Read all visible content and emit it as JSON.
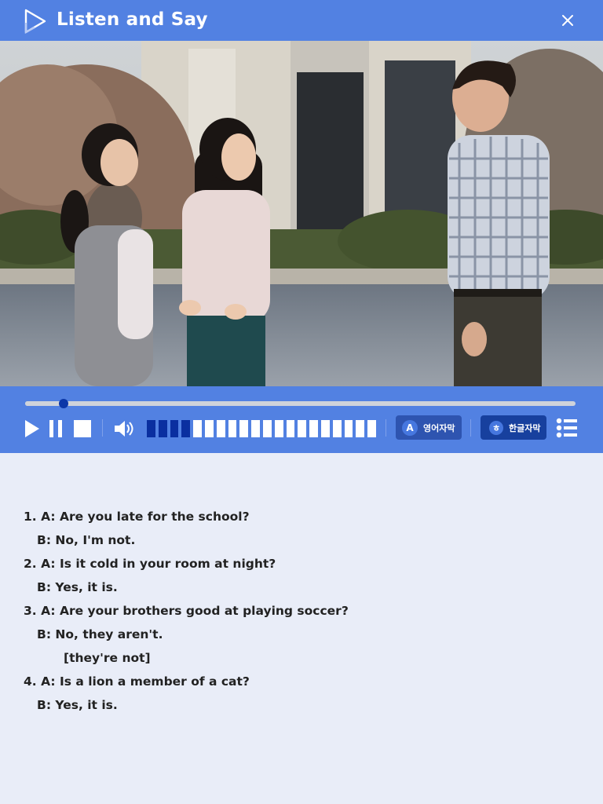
{
  "header": {
    "title": "Listen and Say"
  },
  "player": {
    "progress_fraction": 0.07,
    "volume_level": 4,
    "volume_segments": 20,
    "eng_subtitle": {
      "badge": "A",
      "label": "영어자막"
    },
    "kor_subtitle": {
      "badge": "ㅎ",
      "label": "한글자막"
    }
  },
  "dialog": [
    {
      "text": "1. A: Are you late for the school?",
      "indent": 0
    },
    {
      "text": "B: No, I'm not.",
      "indent": 1
    },
    {
      "text": "2. A: Is it cold in your room at night?",
      "indent": 0
    },
    {
      "text": "B: Yes, it is.",
      "indent": 1
    },
    {
      "text": "3. A: Are your brothers good at playing soccer?",
      "indent": 0
    },
    {
      "text": "B: No, they aren't.",
      "indent": 1
    },
    {
      "text": "[they're not]",
      "indent": 2
    },
    {
      "text": "4. A: Is a lion a member of a cat?",
      "indent": 0
    },
    {
      "text": "B: Yes, it is.",
      "indent": 1
    }
  ],
  "colors": {
    "header_bg": "#5281e2",
    "page_bg": "#e9edf8",
    "accent_dark": "#0c37a8"
  }
}
